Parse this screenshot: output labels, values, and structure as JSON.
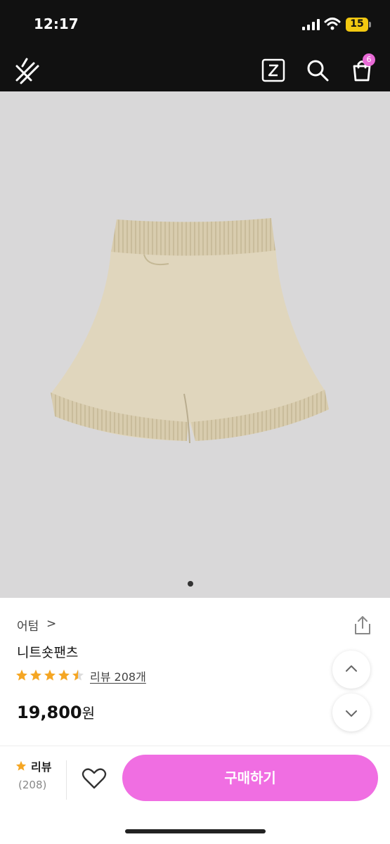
{
  "status_bar": {
    "time": "12:17",
    "battery": "15"
  },
  "header": {
    "logo_icon": "lightning-x-logo-icon",
    "actions": [
      "zigzag-z-icon",
      "search-icon",
      "shopping-bag-icon"
    ],
    "cart_badge": "6"
  },
  "product": {
    "image_icon": "beige-knit-shorts",
    "carousel_pages": 1,
    "brand": "어텀",
    "brand_chevron": ">",
    "name": "니트숏팬츠",
    "rating": 4.5,
    "review_link": "리뷰 208개",
    "price": "19,800",
    "price_unit": "원"
  },
  "bottom_bar": {
    "review_label": "리뷰",
    "review_count": "(208)",
    "buy_label": "구매하기"
  },
  "colors": {
    "topbar": "#111111",
    "accent": "#f06ee2",
    "badge": "#e86ad6",
    "star": "#f5a623",
    "image_bg": "#d9d8d9"
  }
}
